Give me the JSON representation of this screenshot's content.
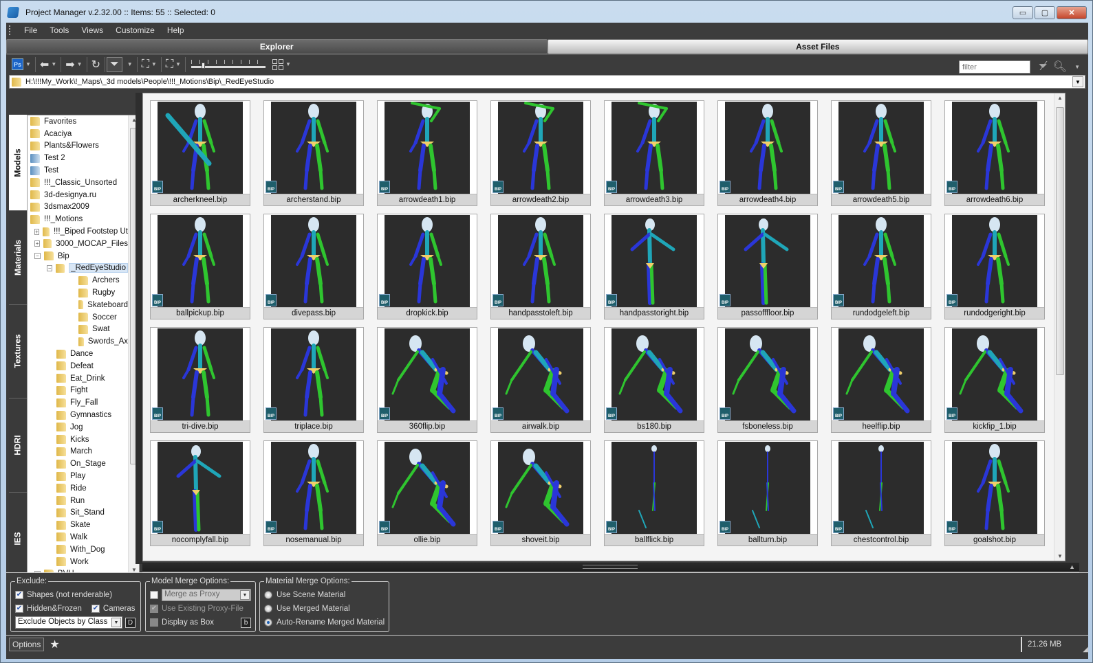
{
  "window": {
    "title": "Project Manager v.2.32.00   :: Items: 55  :: Selected: 0",
    "controls": {
      "minimize": "▭",
      "maximize": "▢",
      "close": "✕"
    }
  },
  "menu": [
    "File",
    "Tools",
    "Views",
    "Customize",
    "Help"
  ],
  "tabs": [
    {
      "label": "Explorer",
      "active": true
    },
    {
      "label": "Asset Files",
      "active": false
    }
  ],
  "toolbar": {
    "icons": [
      "photoshop-icon",
      "back-icon",
      "forward-icon",
      "refresh-icon",
      "filter-icon",
      "merge-icon",
      "xref-icon",
      "thumbnail-size-slider",
      "view-mode-icon"
    ],
    "ps_label": "Ps",
    "thumbnail_size": 0.15,
    "filter_placeholder": "filter"
  },
  "path": "H:\\!!!My_Work\\!_Maps\\_3d models\\People\\!!!_Motions\\Bip\\_RedEyeStudio",
  "side_tabs": [
    "Models",
    "Materials",
    "Textures",
    "HDRI",
    "IES"
  ],
  "tree": [
    {
      "label": "Favorites",
      "level": 0,
      "icon": "favorites"
    },
    {
      "label": "Acaciya",
      "level": 0,
      "icon": "folder"
    },
    {
      "label": "Plants&Flowers",
      "level": 0,
      "icon": "folder"
    },
    {
      "label": "Test 2",
      "level": 0,
      "icon": "catalog"
    },
    {
      "label": "Test",
      "level": 0,
      "icon": "catalog"
    },
    {
      "label": "!!!_Classic_Unsorted",
      "level": 0,
      "icon": "folder"
    },
    {
      "label": "3d-designya.ru",
      "level": 0,
      "icon": "folder"
    },
    {
      "label": "3dsmax2009",
      "level": 0,
      "icon": "folder"
    },
    {
      "label": "!!!_Motions",
      "level": 0,
      "icon": "folder"
    },
    {
      "label": "!!!_Biped Footstep Ut",
      "level": 1,
      "icon": "folder",
      "expander": "+"
    },
    {
      "label": "3000_MOCAP_Files",
      "level": 1,
      "icon": "folder",
      "expander": "+"
    },
    {
      "label": "Bip",
      "level": 1,
      "icon": "folder",
      "expander": "−"
    },
    {
      "label": "_RedEyeStudio",
      "level": 2,
      "icon": "folder",
      "expander": "−",
      "selected": true
    },
    {
      "label": "Archers",
      "level": 3,
      "icon": "folder"
    },
    {
      "label": "Rugby",
      "level": 3,
      "icon": "folder"
    },
    {
      "label": "Skateboard",
      "level": 3,
      "icon": "folder"
    },
    {
      "label": "Soccer",
      "level": 3,
      "icon": "folder"
    },
    {
      "label": "Swat",
      "level": 3,
      "icon": "folder"
    },
    {
      "label": "Swords_Ax",
      "level": 3,
      "icon": "folder"
    },
    {
      "label": "Dance",
      "level": 2,
      "icon": "folder"
    },
    {
      "label": "Defeat",
      "level": 2,
      "icon": "folder"
    },
    {
      "label": "Eat_Drink",
      "level": 2,
      "icon": "folder"
    },
    {
      "label": "Fight",
      "level": 2,
      "icon": "folder"
    },
    {
      "label": "Fly_Fall",
      "level": 2,
      "icon": "folder"
    },
    {
      "label": "Gymnastics",
      "level": 2,
      "icon": "folder"
    },
    {
      "label": "Jog",
      "level": 2,
      "icon": "folder"
    },
    {
      "label": "Kicks",
      "level": 2,
      "icon": "folder"
    },
    {
      "label": "March",
      "level": 2,
      "icon": "folder"
    },
    {
      "label": "On_Stage",
      "level": 2,
      "icon": "folder"
    },
    {
      "label": "Play",
      "level": 2,
      "icon": "folder"
    },
    {
      "label": "Ride",
      "level": 2,
      "icon": "folder"
    },
    {
      "label": "Run",
      "level": 2,
      "icon": "folder"
    },
    {
      "label": "Sit_Stand",
      "level": 2,
      "icon": "folder"
    },
    {
      "label": "Skate",
      "level": 2,
      "icon": "folder"
    },
    {
      "label": "Walk",
      "level": 2,
      "icon": "folder"
    },
    {
      "label": "With_Dog",
      "level": 2,
      "icon": "folder"
    },
    {
      "label": "Work",
      "level": 2,
      "icon": "folder"
    },
    {
      "label": "BVH",
      "level": 1,
      "icon": "folder",
      "expander": "+"
    }
  ],
  "thumbnails": [
    {
      "name": "archerkneel.bip",
      "pose": "kneel"
    },
    {
      "name": "archerstand.bip",
      "pose": "stand"
    },
    {
      "name": "arrowdeath1.bip",
      "pose": "armup"
    },
    {
      "name": "arrowdeath2.bip",
      "pose": "armup"
    },
    {
      "name": "arrowdeath3.bip",
      "pose": "armup"
    },
    {
      "name": "arrowdeath4.bip",
      "pose": "stand"
    },
    {
      "name": "arrowdeath5.bip",
      "pose": "stand"
    },
    {
      "name": "arrowdeath6.bip",
      "pose": "stand"
    },
    {
      "name": "ballpickup.bip",
      "pose": "stand"
    },
    {
      "name": "divepass.bip",
      "pose": "stand"
    },
    {
      "name": "dropkick.bip",
      "pose": "stand"
    },
    {
      "name": "handpasstoleft.bip",
      "pose": "stand"
    },
    {
      "name": "handpasstoright.bip",
      "pose": "side"
    },
    {
      "name": "passofffloor.bip",
      "pose": "side"
    },
    {
      "name": "rundodgeleft.bip",
      "pose": "stand"
    },
    {
      "name": "rundodgeright.bip",
      "pose": "stand"
    },
    {
      "name": "tri-dive.bip",
      "pose": "stand"
    },
    {
      "name": "triplace.bip",
      "pose": "stand"
    },
    {
      "name": "360flip.bip",
      "pose": "crouch"
    },
    {
      "name": "airwalk.bip",
      "pose": "crouch"
    },
    {
      "name": "bs180.bip",
      "pose": "crouch"
    },
    {
      "name": "fsboneless.bip",
      "pose": "crouch"
    },
    {
      "name": "heelflip.bip",
      "pose": "crouch"
    },
    {
      "name": "kickfip_1.bip",
      "pose": "crouch"
    },
    {
      "name": "nocomplyfall.bip",
      "pose": "side"
    },
    {
      "name": "nosemanual.bip",
      "pose": "stand"
    },
    {
      "name": "ollie.bip",
      "pose": "crouch"
    },
    {
      "name": "shoveit.bip",
      "pose": "crouch"
    },
    {
      "name": "ballflick.bip",
      "pose": "tiny"
    },
    {
      "name": "ballturn.bip",
      "pose": "tiny"
    },
    {
      "name": "chestcontrol.bip",
      "pose": "tiny"
    },
    {
      "name": "goalshot.bip",
      "pose": "stand"
    }
  ],
  "thumb_badge": "BIP",
  "exclude": {
    "legend": "Exclude:",
    "shapes": {
      "label": "Shapes (not renderable)",
      "checked": true
    },
    "hidden_frozen": {
      "label": "Hidden&Frozen",
      "checked": true
    },
    "cameras": {
      "label": "Cameras",
      "checked": true
    },
    "class_select": "Exclude Objects by Class",
    "d_button": "D"
  },
  "model_merge": {
    "legend": "Model Merge Options:",
    "proxy_select": "Merge as Proxy",
    "use_existing": {
      "label": "Use Existing Proxy-File",
      "checked": true,
      "disabled": true
    },
    "display_box": {
      "label": "Display as Box",
      "checked": false
    },
    "b_button": "b"
  },
  "material_merge": {
    "legend": "Material Merge Options:",
    "options": [
      {
        "label": "Use Scene Material",
        "selected": false
      },
      {
        "label": "Use Merged Material",
        "selected": false
      },
      {
        "label": "Auto-Rename Merged Material",
        "selected": true
      }
    ]
  },
  "status": {
    "options_label": "Options",
    "memory": "21.26 MB"
  }
}
